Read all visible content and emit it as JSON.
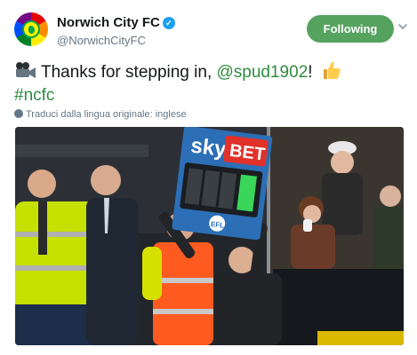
{
  "account": {
    "display_name": "Norwich City FC",
    "handle": "@NorwichCityFC",
    "verified": true,
    "avatar_icon": "rainbow-club-crest-icon"
  },
  "follow_button": {
    "label": "Following",
    "color": "#56a25f"
  },
  "tweet": {
    "emoji_prefix": "movie-camera-icon",
    "text_before": "Thanks for stepping in, ",
    "mention": "@spud1902",
    "text_after": "! ",
    "emoji_suffix": "thumbs-up-icon",
    "hashtag": "#ncfc",
    "link_color": "#2e8b3f"
  },
  "translation_note": "Traduci dalla lingua originale: inglese",
  "media": {
    "board_brand_left": "sky",
    "board_brand_right": "BET",
    "board_badge": "EFL"
  }
}
